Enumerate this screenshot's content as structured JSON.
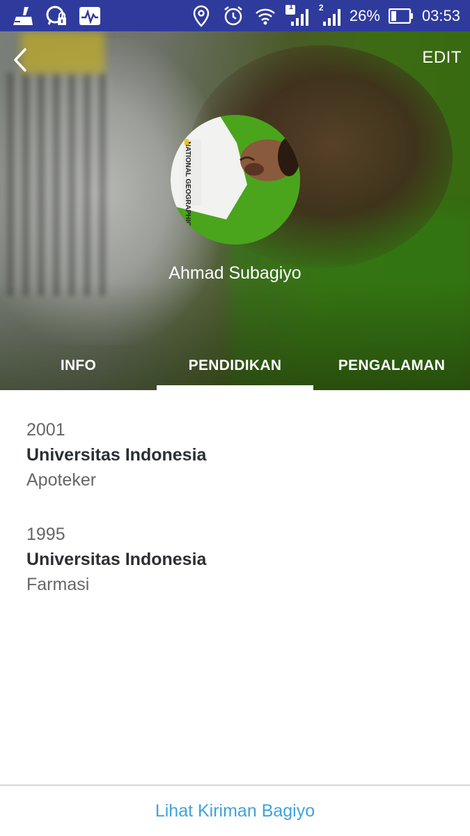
{
  "status_bar": {
    "left_icons": [
      "cleaner-icon",
      "whatsapp-lock-icon",
      "pulse-icon"
    ],
    "right_icons": [
      "location-icon",
      "alarm-icon",
      "wifi-icon",
      "signal-sim1-icon",
      "signal-sim2-icon",
      "battery-icon"
    ],
    "sim1_badge": "1",
    "sim2_badge": "2",
    "battery_percent": "26%",
    "time": "03:53"
  },
  "header": {
    "back_icon": "chevron-left-icon",
    "edit_label": "EDIT",
    "avatar_shirt_text": "NATIONAL GEOGRAPHIC APOTEKER",
    "profile_name": "Ahmad Subagiyo"
  },
  "tabs": [
    {
      "label": "INFO",
      "active": false
    },
    {
      "label": "PENDIDIKAN",
      "active": true
    },
    {
      "label": "PENGALAMAN",
      "active": false
    }
  ],
  "education": [
    {
      "year": "2001",
      "school": "Universitas Indonesia",
      "degree": "Apoteker"
    },
    {
      "year": "1995",
      "school": "Universitas Indonesia",
      "degree": "Farmasi"
    }
  ],
  "footer": {
    "link_label": "Lihat Kiriman Bagiyo"
  },
  "colors": {
    "status_bar_bg": "#2f3b9c",
    "link": "#3ea3dc",
    "school_text": "#2b2f36",
    "muted_text": "#666666"
  }
}
